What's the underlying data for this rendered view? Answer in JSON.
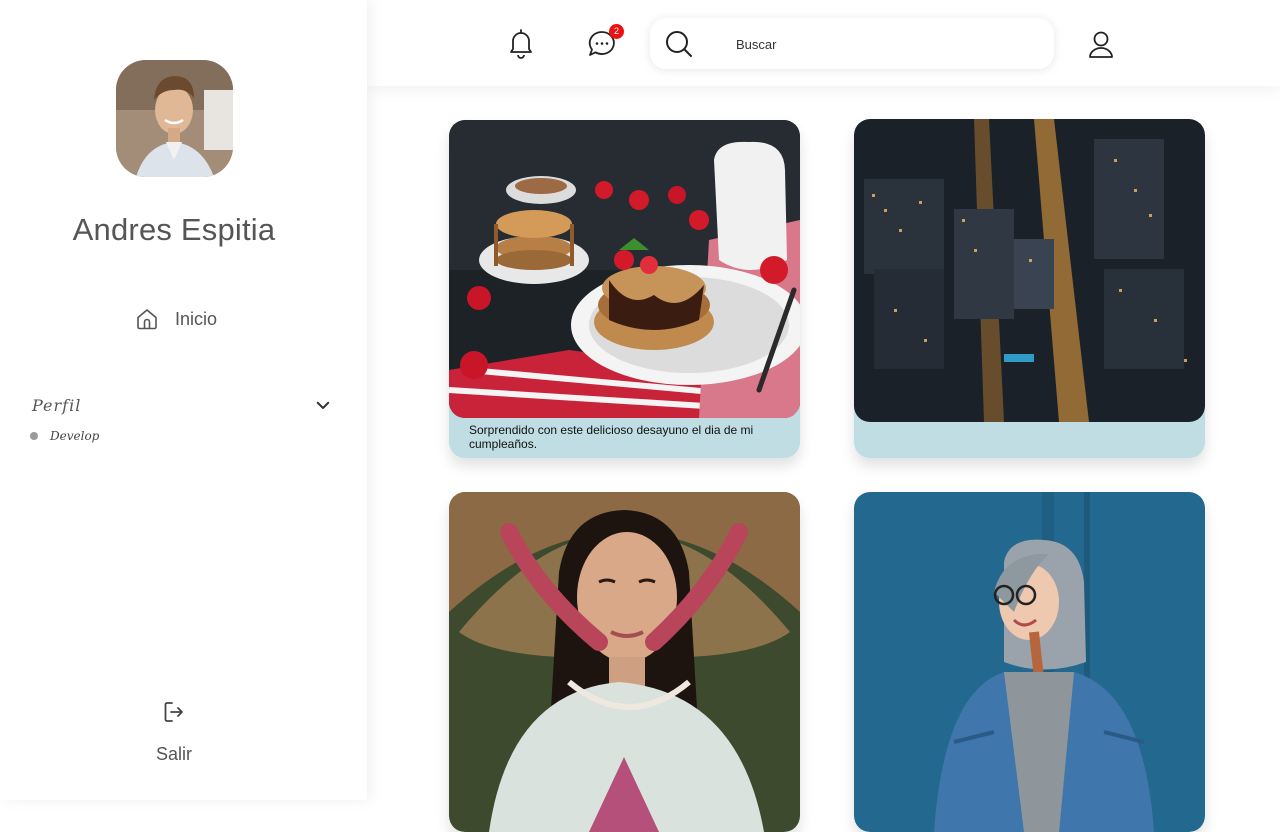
{
  "sidebar": {
    "user_name": "Andres Espitia",
    "avatar_icon": "user-avatar-photo",
    "nav": [
      {
        "label": "Inicio",
        "icon": "home-icon"
      }
    ],
    "profile_menu": {
      "label": "Perfil",
      "expanded": true,
      "items": [
        {
          "label": "Develop"
        }
      ]
    },
    "logout_label": "Salir"
  },
  "topbar": {
    "notifications_icon": "bell-icon",
    "messages_icon": "chat-icon",
    "messages_badge": "2",
    "search_placeholder": "Buscar",
    "user_icon": "user-icon"
  },
  "feed": {
    "posts": [
      {
        "caption": "Sorprendido con este delicioso desayuno el dia de mi cumpleaños.",
        "image": "pancakes-breakfast-photo"
      },
      {
        "caption": "",
        "image": "city-night-aerial-photo"
      },
      {
        "caption": "",
        "image": "woman-conical-hat-photo"
      },
      {
        "caption": "",
        "image": "woman-hoodie-blue-wall-photo"
      }
    ]
  },
  "colors": {
    "card_caption_bg": "#bfdde2",
    "badge_bg": "#ee1111",
    "text": "#555555"
  }
}
